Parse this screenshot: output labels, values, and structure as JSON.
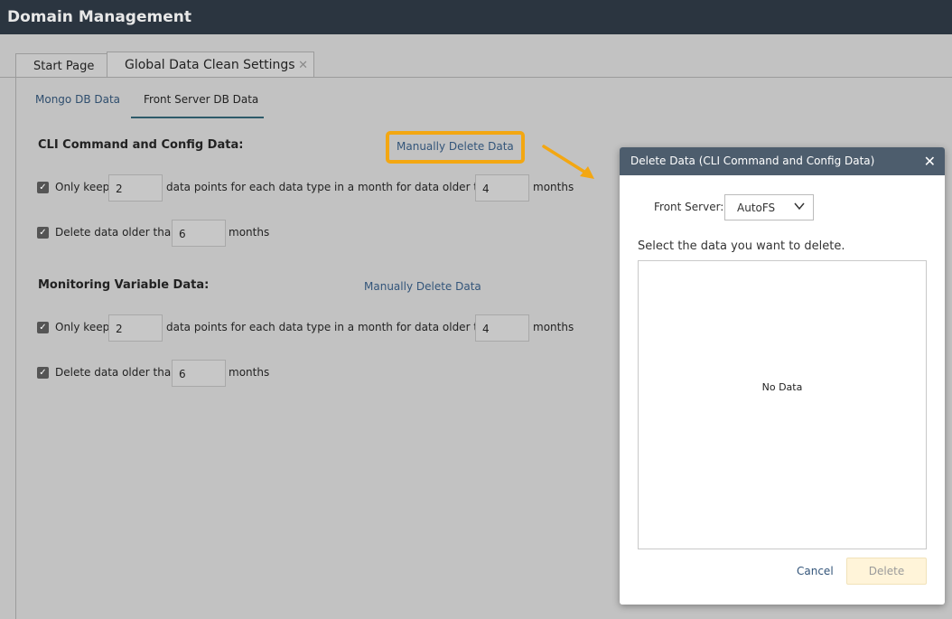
{
  "app": {
    "title": "Domain Management"
  },
  "tabs": [
    {
      "label": "Start Page"
    },
    {
      "label": "Global Data Clean Settings",
      "close_icon": "close-icon"
    }
  ],
  "subtabs": [
    {
      "label": "Mongo DB Data"
    },
    {
      "label": "Front Server DB Data",
      "selected": true
    }
  ],
  "sections": [
    {
      "title": "CLI Command and Config Data:",
      "manual_link": "Manually Delete Data",
      "highlighted": true,
      "row1": {
        "checked": true,
        "prefix": "Only keep",
        "points": "2",
        "middle": "data points for each data type in a month for data older than",
        "months": "4",
        "suffix": "months"
      },
      "row2": {
        "checked": true,
        "prefix": "Delete data older than",
        "months": "6",
        "suffix": "months"
      }
    },
    {
      "title": "Monitoring Variable Data:",
      "manual_link": "Manually Delete Data",
      "row1": {
        "checked": true,
        "prefix": "Only keep",
        "points": "2",
        "middle": "data points for each data type in a month for data older than",
        "months": "4",
        "suffix": "months"
      },
      "row2": {
        "checked": true,
        "prefix": "Delete data older than",
        "months": "6",
        "suffix": "months"
      }
    }
  ],
  "modal": {
    "title": "Delete Data (CLI Command and Config Data)",
    "front_server_label": "Front Server:",
    "front_server_value": "AutoFS",
    "prompt": "Select the data you want to delete.",
    "empty_text": "No Data",
    "cancel_label": "Cancel",
    "delete_label": "Delete"
  },
  "colors": {
    "highlight": "#f3a712",
    "header": "#4d5d6d",
    "titlebar": "#2b3540"
  }
}
